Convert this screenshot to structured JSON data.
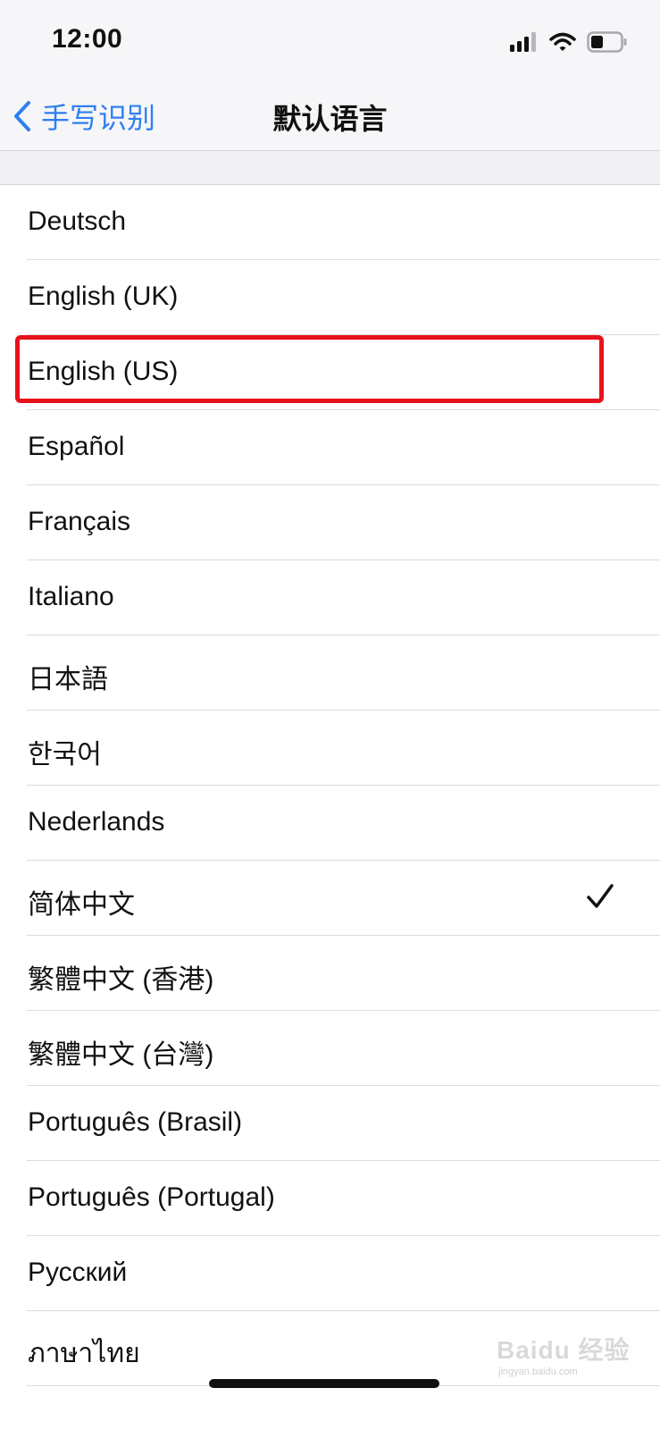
{
  "status_bar": {
    "time": "12:00",
    "icons": [
      "signal-icon",
      "wifi-icon",
      "battery-icon"
    ]
  },
  "nav": {
    "back_label": "手写识别",
    "back_icon": "chevron-left-icon",
    "title": "默认语言"
  },
  "languages": [
    {
      "label": "Deutsch"
    },
    {
      "label": "English (UK)"
    },
    {
      "label": "English (US)",
      "highlighted": true
    },
    {
      "label": "Español"
    },
    {
      "label": "Français"
    },
    {
      "label": "Italiano"
    },
    {
      "label": "日本語"
    },
    {
      "label": "한국어"
    },
    {
      "label": "Nederlands"
    },
    {
      "label": "简体中文",
      "selected": true
    },
    {
      "label": "繁體中文 (香港)"
    },
    {
      "label": "繁體中文 (台灣)"
    },
    {
      "label": "Português (Brasil)"
    },
    {
      "label": "Português (Portugal)"
    },
    {
      "label": "Русский"
    },
    {
      "label": "ภาษาไทย"
    }
  ],
  "watermark": {
    "text": "Baidu 经验",
    "sub": "jingyan.baidu.com"
  },
  "colors": {
    "accent": "#2f7ff0",
    "highlight": "#e8121c",
    "header_bg": "#f6f6f8",
    "text": "#111111"
  }
}
